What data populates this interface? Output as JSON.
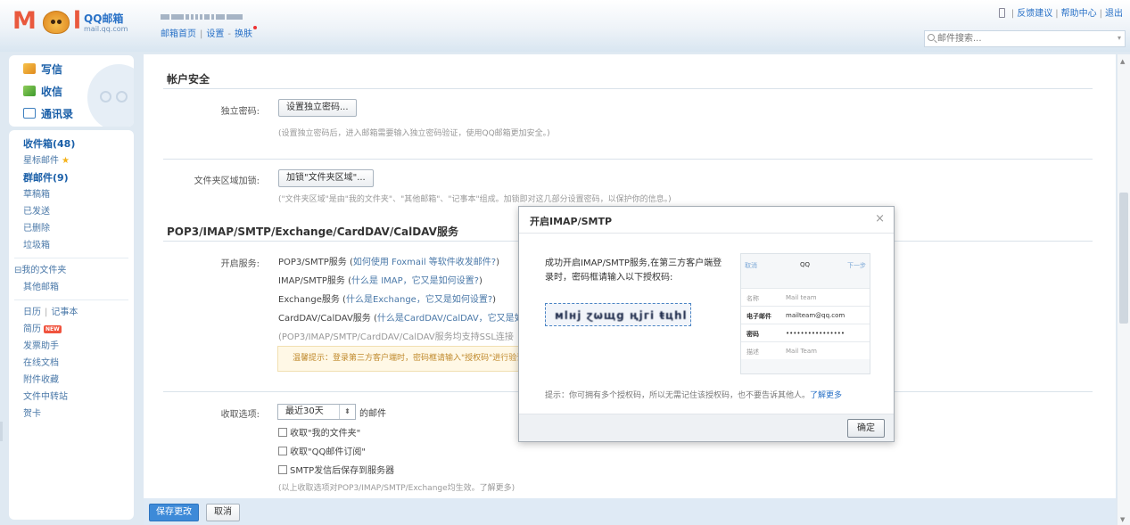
{
  "header": {
    "brand": "QQ邮箱",
    "brand_url": "mail.qq.com",
    "nav": [
      "邮箱首页",
      "设置",
      "换肤"
    ],
    "top_right_links": [
      "反馈建议",
      "帮助中心",
      "退出"
    ],
    "search_placeholder": "邮件搜索..."
  },
  "sidebar": {
    "actions": [
      "写信",
      "收信",
      "通讯录"
    ],
    "inbox": "收件箱(48)",
    "starred": "星标邮件",
    "group": "群邮件(9)",
    "drafts": "草稿箱",
    "sent": "已发送",
    "deleted": "已删除",
    "trash": "垃圾箱",
    "my_folders": "⊟我的文件夹",
    "other_mailboxes": "其他邮箱",
    "calendar": "日历",
    "notes": "记事本",
    "resume": "简历",
    "new_badge": "NEW",
    "invoice": "发票助手",
    "docs": "在线文档",
    "attachments": "附件收藏",
    "transfer": "文件中转站",
    "cards": "贺卡"
  },
  "main": {
    "account_security_title": "帐户安全",
    "independent_pwd_label": "独立密码:",
    "independent_pwd_button": "设置独立密码...",
    "independent_pwd_hint": "(设置独立密码后，进入邮箱需要输入独立密码验证，使用QQ邮箱更加安全。)",
    "folder_lock_label": "文件夹区域加锁:",
    "folder_lock_button": "加锁\"文件夹区域\"...",
    "folder_lock_hint": "(\"文件夹区域\"是由\"我的文件夹\"、\"其他邮箱\"、\"记事本\"组成。加锁即对这几部分设置密码，以保护你的信息。)",
    "pop_title": "POP3/IMAP/SMTP/Exchange/CardDAV/CalDAV服务",
    "enable_label": "开启服务:",
    "services": [
      {
        "name": "POP3/SMTP服务",
        "link": "如何使用 Foxmail 等软件收发邮件?"
      },
      {
        "name": "IMAP/SMTP服务",
        "link": "什么是 IMAP，它又是如何设置?"
      },
      {
        "name": "Exchange服务",
        "link": "什么是Exchange，它又是如何设置?"
      },
      {
        "name": "CardDAV/CalDAV服务",
        "link": "什么是CardDAV/CalDAV，它又是如何设置?"
      }
    ],
    "ssl_note": "(POP3/IMAP/SMTP/CardDAV/CalDAV服务均支持SSL连接",
    "warning": "温馨提示：登录第三方客户端时，密码框请输入\"授权码\"进行验证",
    "receive_label": "收取选项:",
    "receive_select": "最近30天",
    "receive_suffix": "的邮件",
    "checkbox_1": "收取\"我的文件夹\"",
    "checkbox_2": "收取\"QQ邮件订阅\"",
    "checkbox_3": "SMTP发信后保存到服务器",
    "receive_note": "(以上收取选项对POP3/IMAP/SMTP/Exchange均生效。了解更多)",
    "save_button": "保存更改",
    "cancel_button": "取消"
  },
  "modal": {
    "title": "开启IMAP/SMTP",
    "close": "×",
    "message": "成功开启IMAP/SMTP服务,在第三方客户端登录时，密码框请输入以下授权码:",
    "auth_code": "мlнј ɀѡщg ңјгi ŧцһl",
    "card": {
      "cancel": "取消",
      "app": "QQ",
      "next": "下一步",
      "rows": [
        {
          "k": "名称",
          "v": "Mail team"
        },
        {
          "k": "电子邮件",
          "v": "mailteam@qq.com"
        },
        {
          "k": "密码",
          "v": "••••••••••••••••"
        },
        {
          "k": "描述",
          "v": "Mail Team"
        }
      ]
    },
    "tip": "提示：你可拥有多个授权码，所以无需记住该授权码，也不要告诉其他人。",
    "tip_link": "了解更多",
    "ok_button": "确定"
  }
}
